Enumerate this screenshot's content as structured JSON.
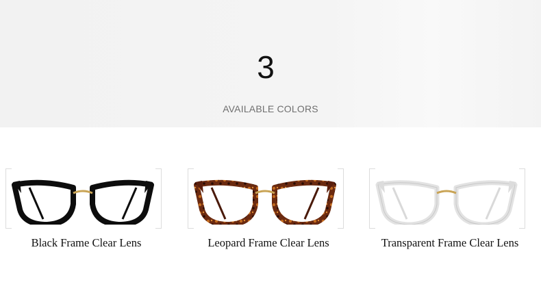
{
  "header": {
    "count": "3",
    "label": "AVAILABLE COLORS"
  },
  "products": [
    {
      "caption": "Black Frame Clear Lens",
      "frame_color": "#0d0d0d",
      "temple_color": "#0d0d0d"
    },
    {
      "caption": "Leopard Frame Clear Lens",
      "frame_color": "#5a1e0c",
      "temple_color": "#4a1a0a"
    },
    {
      "caption": "Transparent Frame Clear Lens",
      "frame_color": "#e6e6e6",
      "temple_color": "#d9d9d9"
    }
  ],
  "colors": {
    "header_background": "#f3f3f3",
    "bridge_gold": "#c9a455",
    "label_gray": "#6f6f6f"
  }
}
